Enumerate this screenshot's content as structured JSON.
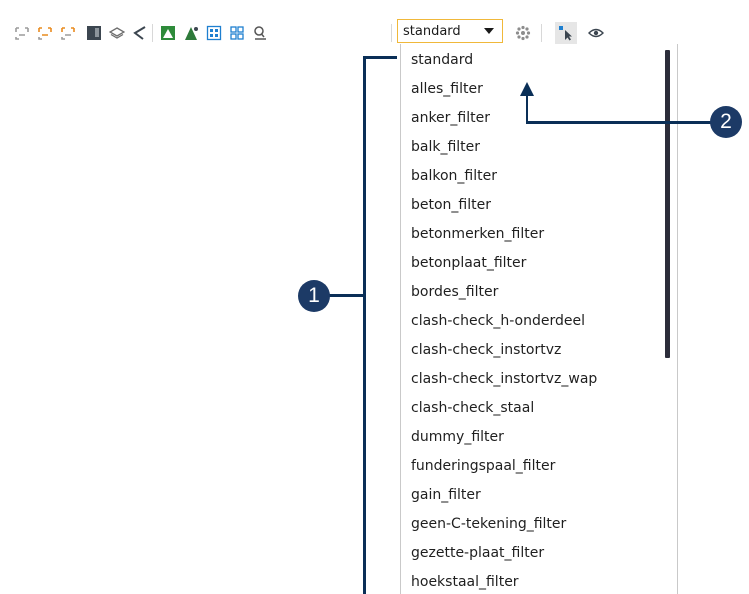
{
  "toolbar": {
    "icons": [
      "select-dim-icon",
      "select-orange-icon",
      "select-orange2-icon",
      "save-view-icon",
      "layers-icon",
      "angle-icon",
      "green-square-icon",
      "tree-icon",
      "grid-select-icon",
      "grid-select2-icon",
      "magnifier-icon"
    ],
    "filter_value": "standard",
    "right_icons": [
      "filter-settings-icon",
      "select-pointer-icon",
      "eye-icon"
    ]
  },
  "dropdown": {
    "items": [
      "standard",
      "alles_filter",
      "anker_filter",
      "balk_filter",
      "balkon_filter",
      "beton_filter",
      "betonmerken_filter",
      "betonplaat_filter",
      "bordes_filter",
      "clash-check_h-onderdeel",
      "clash-check_instortvz",
      "clash-check_instortvz_wap",
      "clash-check_staal",
      "dummy_filter",
      "funderingspaal_filter",
      "gain_filter",
      "geen-C-tekening_filter",
      "gezette-plaat_filter",
      "hoekstaal_filter"
    ]
  },
  "callouts": {
    "one": "1",
    "two": "2"
  },
  "colors": {
    "accent": "#f0b83a",
    "callout": "#1c3a66",
    "line": "#0a2f57",
    "scrollbar": "#2c2d3a"
  }
}
